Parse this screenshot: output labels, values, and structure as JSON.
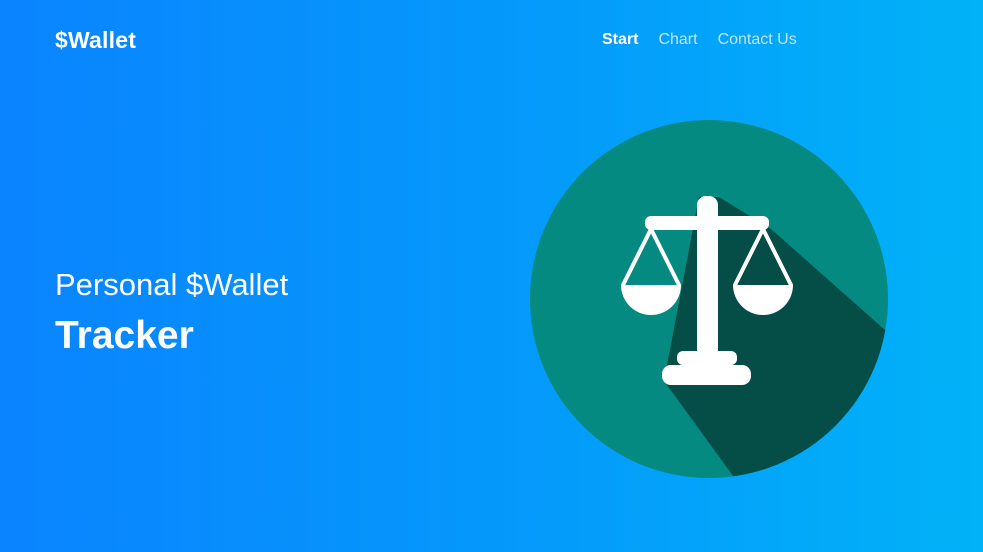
{
  "header": {
    "brand": "$Wallet",
    "nav": [
      {
        "label": "Start",
        "active": true
      },
      {
        "label": "Chart",
        "active": false
      },
      {
        "label": "Contact Us",
        "active": false
      }
    ]
  },
  "hero": {
    "line1": "Personal $Wallet",
    "line2": "Tracker"
  },
  "illustration": {
    "icon": "scales-icon",
    "circle_color": "#048a80",
    "shadow_color": "#054a43",
    "icon_color": "#ffffff"
  },
  "colors": {
    "gradient_start": "#0a84ff",
    "gradient_end": "#01b2f8",
    "nav_inactive": "#bfe4ff"
  }
}
